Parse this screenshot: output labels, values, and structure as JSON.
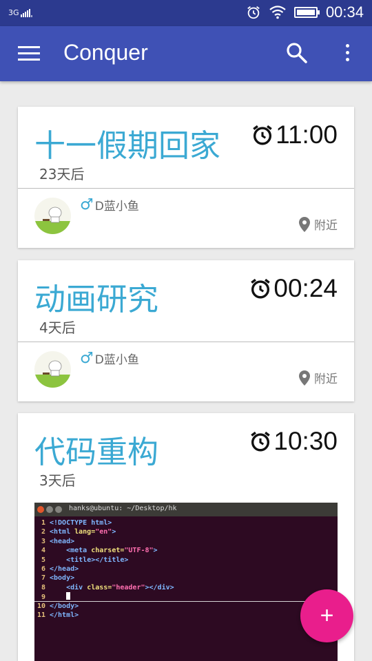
{
  "status_bar": {
    "network": "3G",
    "time": "00:34"
  },
  "app_bar": {
    "title": "Conquer"
  },
  "cards": [
    {
      "title": "十一假期回家",
      "time": "11:00",
      "days": "23天后",
      "user": "D蓝小鱼",
      "gender_icon": "♂",
      "location": "附近"
    },
    {
      "title": "动画研究",
      "time": "00:24",
      "days": "4天后",
      "user": "D蓝小鱼",
      "gender_icon": "♂",
      "location": "附近"
    },
    {
      "title": "代码重构",
      "time": "10:30",
      "days": "3天后",
      "terminal": {
        "title": "hanks@ubuntu: ~/Desktop/hk"
      }
    }
  ],
  "fab": {
    "label": "+"
  },
  "colors": {
    "status_bar": "#2c3a8f",
    "app_bar": "#3f51b5",
    "title_accent": "#3ba9d3",
    "fab": "#e91e8c"
  },
  "icons": [
    "signal-icon",
    "alarm-status-icon",
    "wifi-icon",
    "battery-icon",
    "menu-icon",
    "search-icon",
    "more-vert-icon",
    "alarm-clock-icon",
    "male-icon",
    "location-pin-icon",
    "add-icon"
  ]
}
